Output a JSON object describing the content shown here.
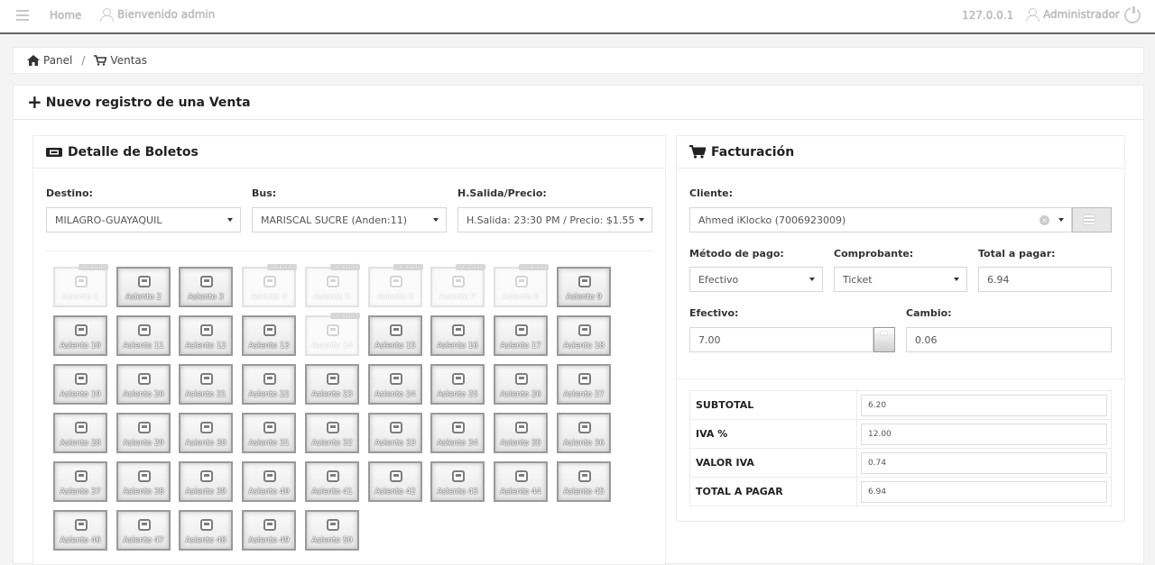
{
  "topbar": {
    "home": "Home",
    "welcome": "Bienvenido admin",
    "ip": "127.0.0.1",
    "user": "Administrador"
  },
  "breadcrumb": {
    "panel": "Panel",
    "ventas": "Ventas"
  },
  "main": {
    "title": "Nuevo registro de una Venta"
  },
  "boletos": {
    "title": "Detalle de Boletos",
    "destino_label": "Destino:",
    "destino_value": "MILAGRO-GUAYAQUIL",
    "bus_label": "Bus:",
    "bus_value": "MARISCAL SUCRE (Anden:11)",
    "salida_label": "H.Salida/Precio:",
    "salida_value": "H.Salida: 23:30 PM / Precio: $1.55",
    "occupied_tag": "Ocupado",
    "seats": [
      {
        "label": "Asiento 1",
        "occupied": true
      },
      {
        "label": "Asiento 2",
        "occupied": false
      },
      {
        "label": "Asiento 3",
        "occupied": false
      },
      {
        "label": "Asiento 4",
        "occupied": true
      },
      {
        "label": "Asiento 5",
        "occupied": true
      },
      {
        "label": "Asiento 6",
        "occupied": true
      },
      {
        "label": "Asiento 7",
        "occupied": true
      },
      {
        "label": "Asiento 8",
        "occupied": true
      },
      {
        "label": "Asiento 9",
        "occupied": false
      },
      {
        "label": "Asiento 10",
        "occupied": false
      },
      {
        "label": "Asiento 11",
        "occupied": false
      },
      {
        "label": "Asiento 12",
        "occupied": false
      },
      {
        "label": "Asiento 13",
        "occupied": false
      },
      {
        "label": "Asiento 14",
        "occupied": true
      },
      {
        "label": "Asiento 15",
        "occupied": false
      },
      {
        "label": "Asiento 16",
        "occupied": false
      },
      {
        "label": "Asiento 17",
        "occupied": false
      },
      {
        "label": "Asiento 18",
        "occupied": false
      },
      {
        "label": "Asiento 19",
        "occupied": false
      },
      {
        "label": "Asiento 20",
        "occupied": false
      },
      {
        "label": "Asiento 21",
        "occupied": false
      },
      {
        "label": "Asiento 22",
        "occupied": false
      },
      {
        "label": "Asiento 23",
        "occupied": false
      },
      {
        "label": "Asiento 24",
        "occupied": false
      },
      {
        "label": "Asiento 25",
        "occupied": false
      },
      {
        "label": "Asiento 26",
        "occupied": false
      },
      {
        "label": "Asiento 27",
        "occupied": false
      },
      {
        "label": "Asiento 28",
        "occupied": false
      },
      {
        "label": "Asiento 29",
        "occupied": false
      },
      {
        "label": "Asiento 30",
        "occupied": false
      },
      {
        "label": "Asiento 31",
        "occupied": false
      },
      {
        "label": "Asiento 32",
        "occupied": false
      },
      {
        "label": "Asiento 33",
        "occupied": false
      },
      {
        "label": "Asiento 34",
        "occupied": false
      },
      {
        "label": "Asiento 35",
        "occupied": false
      },
      {
        "label": "Asiento 36",
        "occupied": false
      },
      {
        "label": "Asiento 37",
        "occupied": false
      },
      {
        "label": "Asiento 38",
        "occupied": false
      },
      {
        "label": "Asiento 39",
        "occupied": false
      },
      {
        "label": "Asiento 40",
        "occupied": false
      },
      {
        "label": "Asiento 41",
        "occupied": false
      },
      {
        "label": "Asiento 42",
        "occupied": false
      },
      {
        "label": "Asiento 43",
        "occupied": false
      },
      {
        "label": "Asiento 44",
        "occupied": false
      },
      {
        "label": "Asiento 45",
        "occupied": false
      },
      {
        "label": "Asiento 46",
        "occupied": false
      },
      {
        "label": "Asiento 47",
        "occupied": false
      },
      {
        "label": "Asiento 48",
        "occupied": false
      },
      {
        "label": "Asiento 49",
        "occupied": false
      },
      {
        "label": "Asiento 50",
        "occupied": false
      }
    ]
  },
  "facturacion": {
    "title": "Facturación",
    "cliente_label": "Cliente:",
    "cliente_value": "Ahmed iKlocko (7006923009)",
    "metodo_label": "Método de pago:",
    "metodo_value": "Efectivo",
    "comprobante_label": "Comprobante:",
    "comprobante_value": "Ticket",
    "total_label": "Total a pagar:",
    "total_value": "6.94",
    "efectivo_label": "Efectivo:",
    "efectivo_value": "7.00",
    "cambio_label": "Cambio:",
    "cambio_value": "0.06",
    "totals": [
      {
        "key": "SUBTOTAL",
        "value": "6.20"
      },
      {
        "key": "IVA %",
        "value": "12.00"
      },
      {
        "key": "VALOR IVA",
        "value": "0.74"
      },
      {
        "key": "TOTAL A PAGAR",
        "value": "6.94"
      }
    ]
  }
}
